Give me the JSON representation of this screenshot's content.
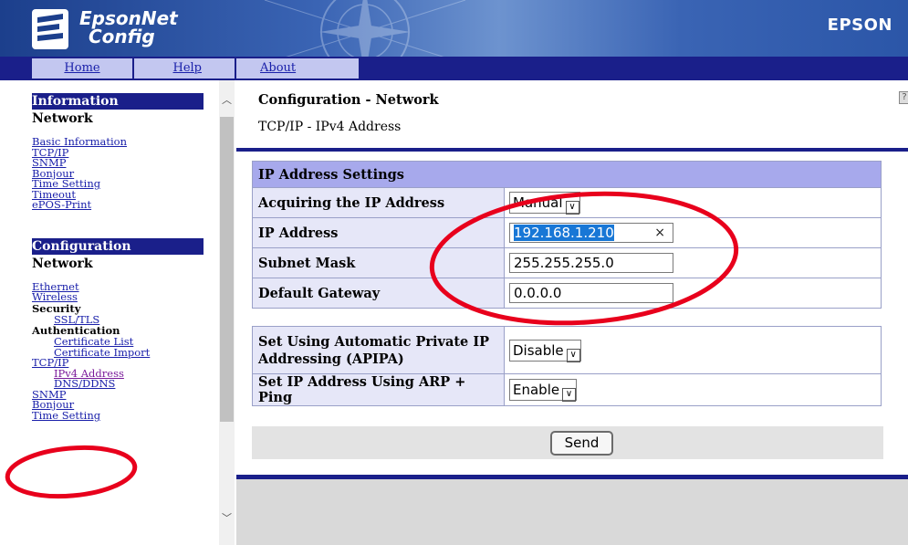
{
  "banner": {
    "product_line1": "EpsonNet",
    "product_line2": "Config",
    "brand": "EPSON"
  },
  "nav": {
    "home": "Home",
    "help": "Help",
    "about": "About"
  },
  "sidebar": {
    "info_header": "Information",
    "info_sub": "Network",
    "info_links": [
      "Basic Information",
      "TCP/IP",
      "SNMP",
      "Bonjour",
      "Time Setting",
      "Timeout",
      "ePOS-Print"
    ],
    "config_header": "Configuration",
    "config_sub": "Network",
    "ethernet": "Ethernet",
    "wireless": "Wireless",
    "security": "Security",
    "ssl_tls": "SSL/TLS",
    "authentication": "Authentication",
    "certificate_list": "Certificate List",
    "certificate_import": "Certificate Import",
    "tcpip": "TCP/IP",
    "ipv4_address": "IPv4 Address",
    "dns_ddns": "DNS/DDNS",
    "snmp": "SNMP",
    "bonjour": "Bonjour",
    "time_setting": "Time Setting"
  },
  "main": {
    "title": "Configuration - Network",
    "subtitle": "TCP/IP - IPv4 Address",
    "help_icon": "?",
    "ip_settings": {
      "header": "IP Address Settings",
      "acquire_label": "Acquiring the IP Address",
      "acquire_value": "Manual",
      "ip_label": "IP Address",
      "ip_value": "192.168.1.210",
      "clear_glyph": "×",
      "subnet_label": "Subnet Mask",
      "subnet_value": "255.255.255.0",
      "gateway_label": "Default Gateway",
      "gateway_value": "0.0.0.0"
    },
    "apipa": {
      "label": "Set Using Automatic Private IP Addressing (APIPA)",
      "value": "Disable"
    },
    "arp_ping": {
      "label": "Set IP Address Using ARP + Ping",
      "value": "Enable"
    },
    "send_label": "Send"
  },
  "colors": {
    "nav_dark": "#1a1f8a",
    "nav_cell": "#c3c7f0",
    "table_header": "#a7a9ec",
    "table_label": "#e6e7f8",
    "annotation": "#e8001c",
    "selection": "#1877d6"
  }
}
